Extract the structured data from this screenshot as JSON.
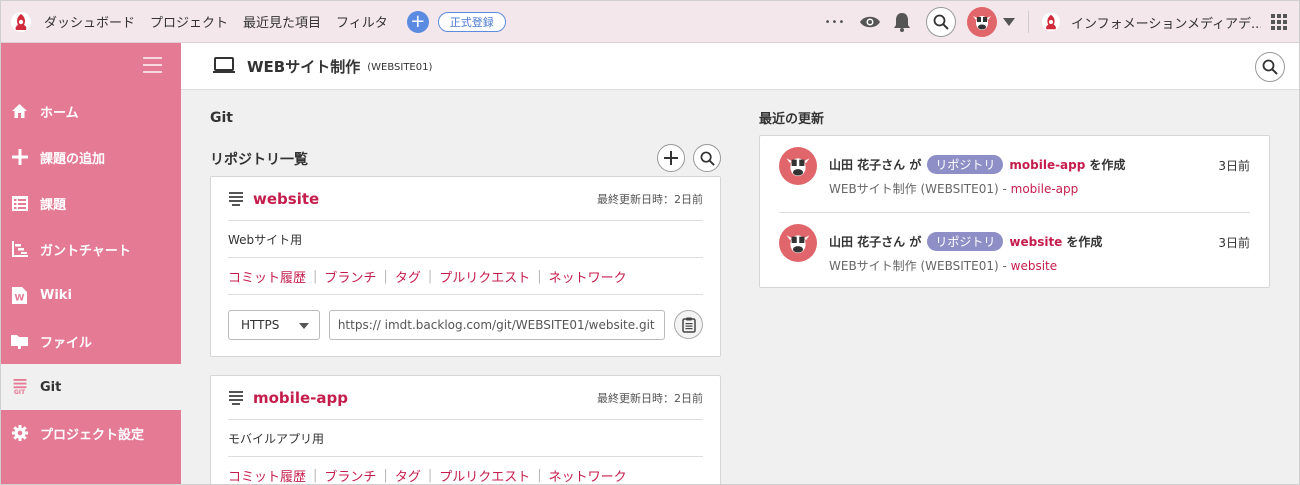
{
  "topbar": {
    "nav": [
      "ダッシュボード",
      "プロジェクト",
      "最近見た項目",
      "フィルタ"
    ],
    "add_label": "+",
    "register_label": "正式登録",
    "org_name": "インフォメーションメディアデ...",
    "more_label": "•••"
  },
  "sidebar": {
    "items": [
      {
        "label": "ホーム",
        "icon": "home-icon"
      },
      {
        "label": "課題の追加",
        "icon": "plus-icon"
      },
      {
        "label": "課題",
        "icon": "list-icon"
      },
      {
        "label": "ガントチャート",
        "icon": "gantt-icon"
      },
      {
        "label": "Wiki",
        "icon": "wiki-icon"
      },
      {
        "label": "ファイル",
        "icon": "folder-icon"
      },
      {
        "label": "Git",
        "icon": "git-icon",
        "active": true,
        "sublabel": "GIT"
      },
      {
        "label": "プロジェクト設定",
        "icon": "gear-icon"
      }
    ]
  },
  "header": {
    "title": "WEBサイト制作",
    "key": "(WEBSITE01)"
  },
  "git": {
    "title": "Git",
    "repo_list_title": "リポジトリ一覧",
    "repos": [
      {
        "name": "website",
        "updated": "最終更新日時：2日前",
        "description": "Webサイト用",
        "links": [
          "コミット履歴",
          "ブランチ",
          "タグ",
          "プルリクエスト",
          "ネットワーク"
        ],
        "protocol": "HTTPS",
        "clone_url": "https:// imdt.backlog.com/git/WEBSITE01/website.git"
      },
      {
        "name": "mobile-app",
        "updated": "最終更新日時：2日前",
        "description": "モバイルアプリ用",
        "links": [
          "コミット履歴",
          "ブランチ",
          "タグ",
          "プルリクエスト",
          "ネットワーク"
        ]
      }
    ]
  },
  "recent": {
    "title": "最近の更新",
    "items": [
      {
        "user": "山田 花子さん が",
        "tag": "リポジトリ",
        "target": "mobile-app",
        "action": "を作成",
        "time": "3日前",
        "project": "WEBサイト制作 (WEBSITE01) -",
        "repo": "mobile-app"
      },
      {
        "user": "山田 花子さん が",
        "tag": "リポジトリ",
        "target": "website",
        "action": "を作成",
        "time": "3日前",
        "project": "WEBサイト制作 (WEBSITE01) -",
        "repo": "website"
      }
    ]
  }
}
